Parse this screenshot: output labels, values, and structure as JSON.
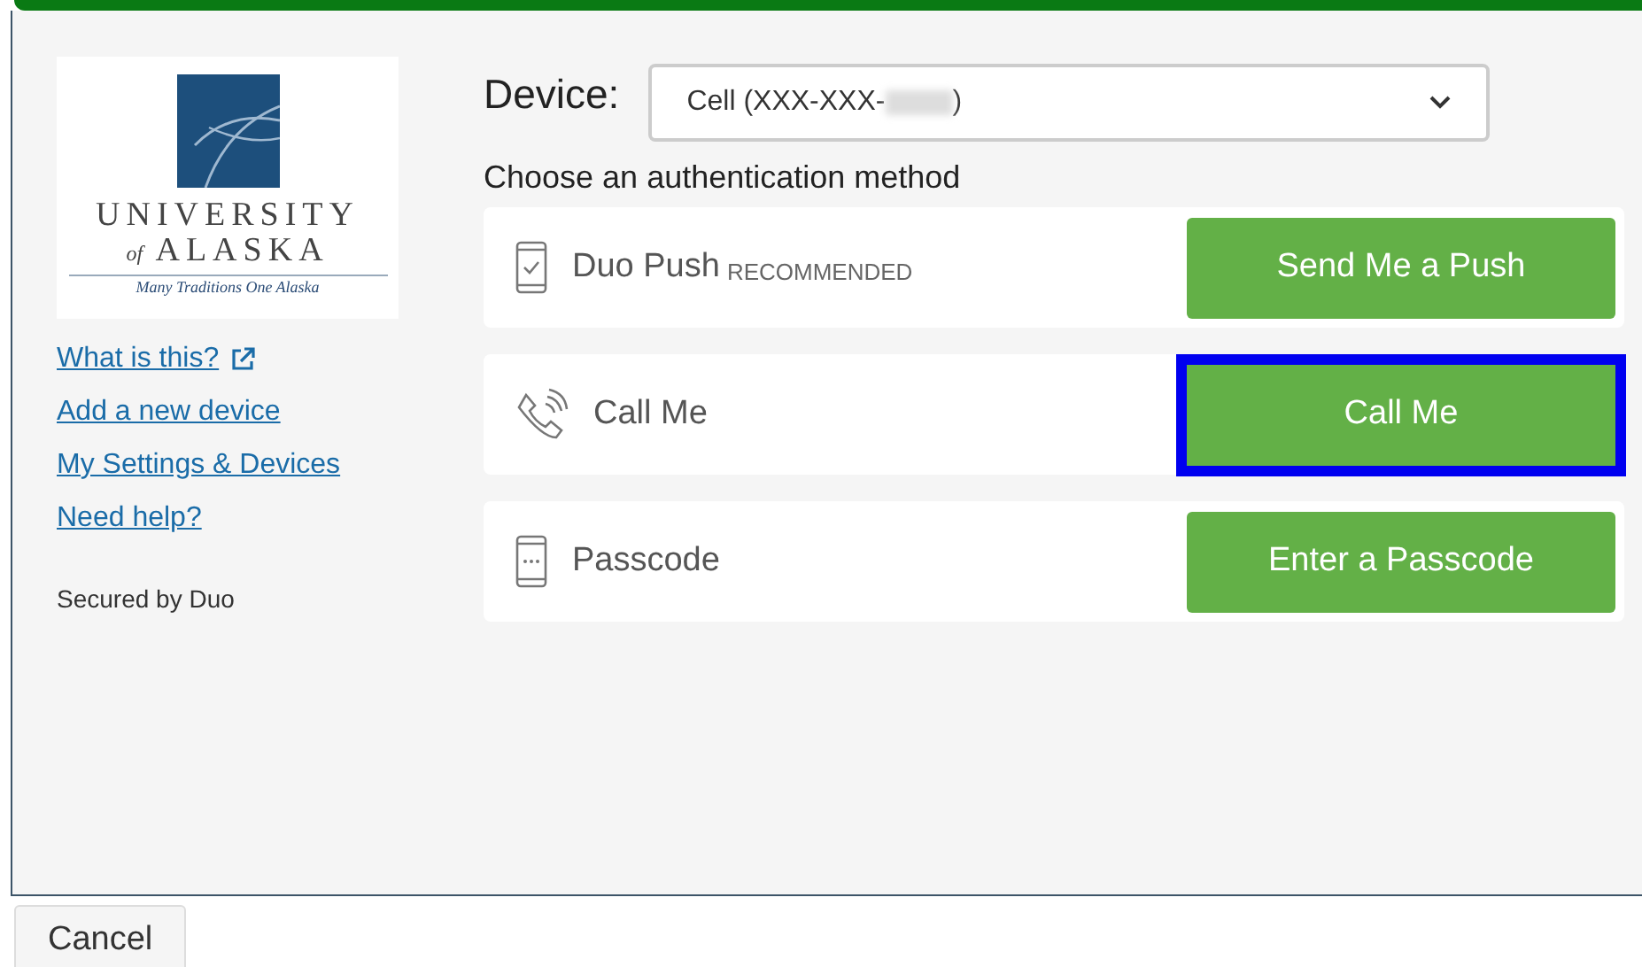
{
  "logo": {
    "line_1": "UNIVERSITY",
    "line_2_small": "of",
    "line_2": "ALASKA",
    "tagline": "Many Traditions One Alaska"
  },
  "links": [
    {
      "label": "What is this?",
      "external": true
    },
    {
      "label": "Add a new device",
      "external": false
    },
    {
      "label": "My Settings & Devices",
      "external": false
    },
    {
      "label": "Need help?",
      "external": false
    }
  ],
  "secured_by": "Secured by Duo",
  "device": {
    "label": "Device:",
    "value_start": "Cell (XXX-XXX-",
    "value_end": ")"
  },
  "prompt": "Choose an authentication method",
  "methods": [
    {
      "kind": "push",
      "label": "Duo Push",
      "badge": "RECOMMENDED",
      "button": "Send Me a Push",
      "focused": false
    },
    {
      "kind": "call",
      "label": "Call Me",
      "button": "Call Me",
      "focused": true
    },
    {
      "kind": "passcode",
      "label": "Passcode",
      "button": "Enter a Passcode",
      "focused": false
    }
  ],
  "cancel": "Cancel"
}
